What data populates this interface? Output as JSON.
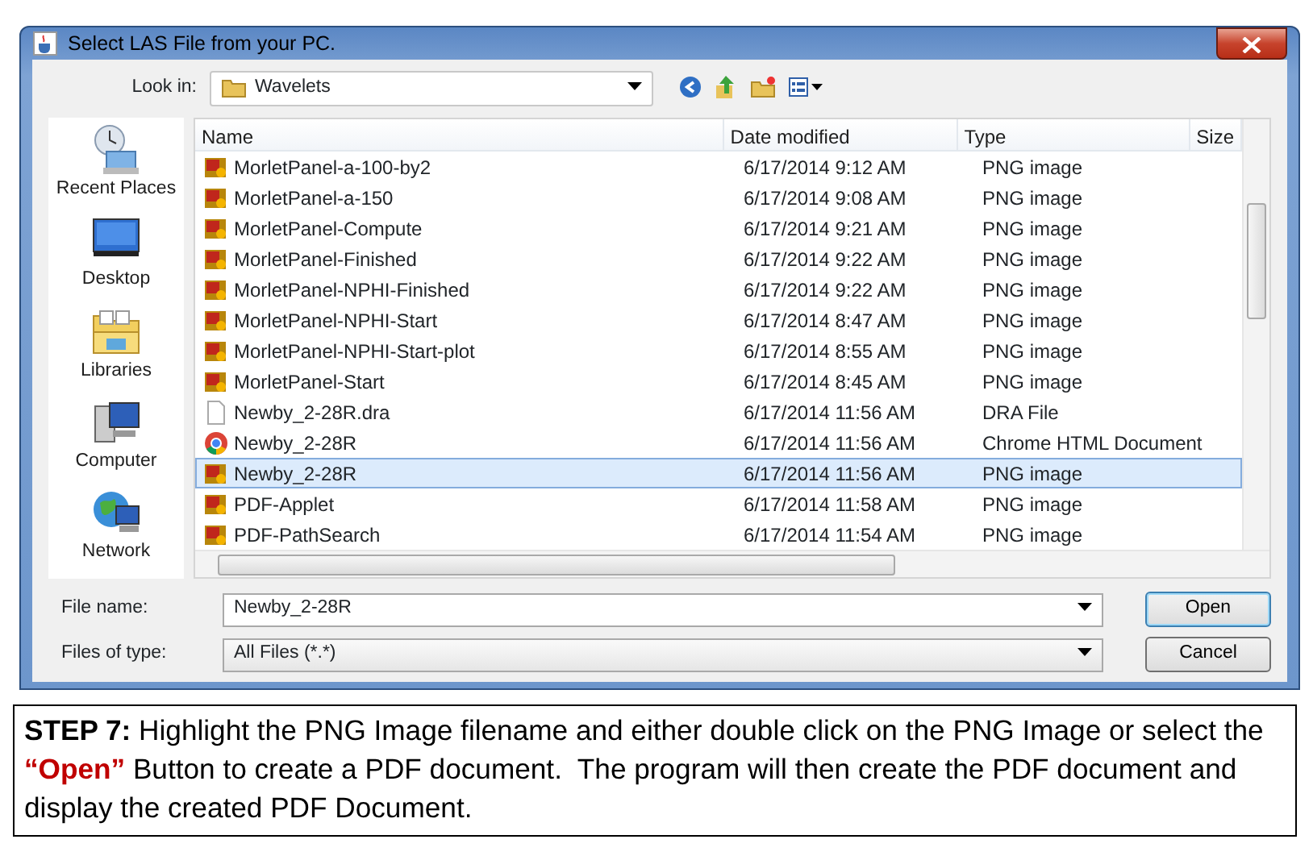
{
  "window": {
    "title": "Select LAS File from your PC."
  },
  "look_in": {
    "label": "Look in:",
    "value": "Wavelets"
  },
  "places": [
    {
      "label": "Recent Places",
      "kind": "recent"
    },
    {
      "label": "Desktop",
      "kind": "desktop"
    },
    {
      "label": "Libraries",
      "kind": "libraries"
    },
    {
      "label": "Computer",
      "kind": "computer"
    },
    {
      "label": "Network",
      "kind": "network"
    }
  ],
  "table": {
    "columns": [
      "Name",
      "Date modified",
      "Type",
      "Size"
    ],
    "rows": [
      {
        "name": "MorletPanel-a-100-by2",
        "date": "6/17/2014 9:12 AM",
        "type": "PNG image",
        "kind": "png",
        "selected": false
      },
      {
        "name": "MorletPanel-a-150",
        "date": "6/17/2014 9:08 AM",
        "type": "PNG image",
        "kind": "png",
        "selected": false
      },
      {
        "name": "MorletPanel-Compute",
        "date": "6/17/2014 9:21 AM",
        "type": "PNG image",
        "kind": "png",
        "selected": false
      },
      {
        "name": "MorletPanel-Finished",
        "date": "6/17/2014 9:22 AM",
        "type": "PNG image",
        "kind": "png",
        "selected": false
      },
      {
        "name": "MorletPanel-NPHI-Finished",
        "date": "6/17/2014 9:22 AM",
        "type": "PNG image",
        "kind": "png",
        "selected": false
      },
      {
        "name": "MorletPanel-NPHI-Start",
        "date": "6/17/2014 8:47 AM",
        "type": "PNG image",
        "kind": "png",
        "selected": false
      },
      {
        "name": "MorletPanel-NPHI-Start-plot",
        "date": "6/17/2014 8:55 AM",
        "type": "PNG image",
        "kind": "png",
        "selected": false
      },
      {
        "name": "MorletPanel-Start",
        "date": "6/17/2014 8:45 AM",
        "type": "PNG image",
        "kind": "png",
        "selected": false
      },
      {
        "name": "Newby_2-28R.dra",
        "date": "6/17/2014 11:56 AM",
        "type": "DRA File",
        "kind": "file",
        "selected": false
      },
      {
        "name": "Newby_2-28R",
        "date": "6/17/2014 11:56 AM",
        "type": "Chrome HTML Document",
        "kind": "chrome",
        "selected": false
      },
      {
        "name": "Newby_2-28R",
        "date": "6/17/2014 11:56 AM",
        "type": "PNG image",
        "kind": "png",
        "selected": true
      },
      {
        "name": "PDF-Applet",
        "date": "6/17/2014 11:58 AM",
        "type": "PNG image",
        "kind": "png",
        "selected": false
      },
      {
        "name": "PDF-PathSearch",
        "date": "6/17/2014 11:54 AM",
        "type": "PNG image",
        "kind": "png",
        "selected": false
      }
    ]
  },
  "file_name": {
    "label": "File name:",
    "value": "Newby_2-28R"
  },
  "file_type": {
    "label": "Files of type:",
    "value": "All Files (*.*)"
  },
  "buttons": [
    {
      "label": "Open",
      "default": true
    },
    {
      "label": "Cancel",
      "default": false
    }
  ],
  "caption": {
    "segments": [
      {
        "text": "STEP 7:",
        "kind": "bold"
      },
      {
        "text": " Highlight the PNG Image filename and either double click on the PNG Image or select the ",
        "kind": "plain"
      },
      {
        "text": "“Open”",
        "kind": "accent"
      },
      {
        "text": " Button to create a PDF document.  The program will then create the PDF document and display the created PDF Document.",
        "kind": "plain"
      }
    ]
  }
}
